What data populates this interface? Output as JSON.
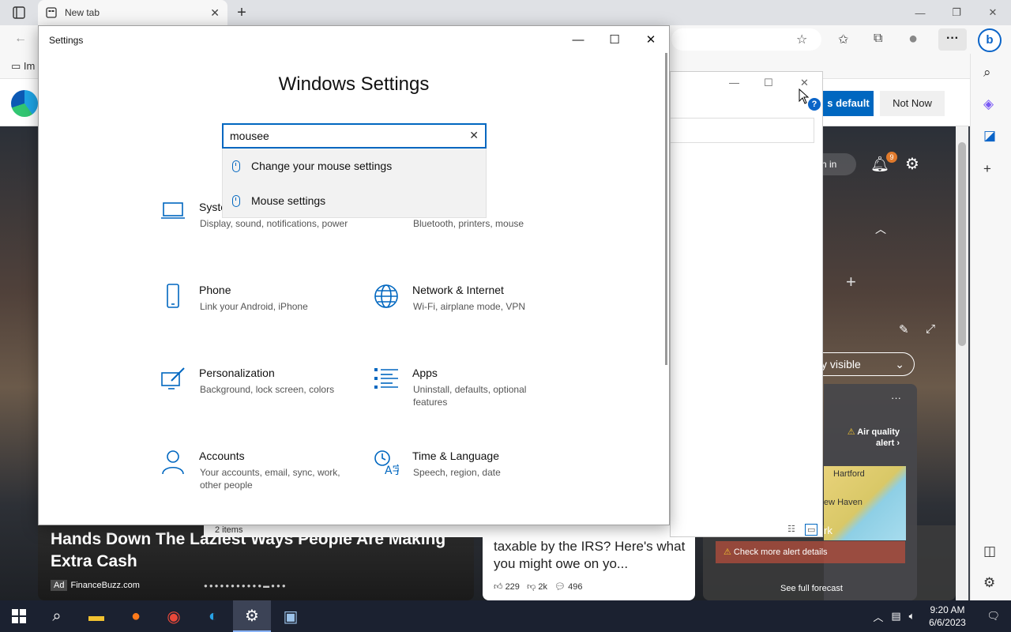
{
  "browser": {
    "tab_title": "New tab",
    "fav_label": "Im",
    "banner_default_label": "s default",
    "banner_not_now_label": "Not Now",
    "sign_in_label": "n in",
    "notification_count": "9",
    "visible_label": "y visible",
    "sidebar_bing_label": "b"
  },
  "settings": {
    "app_title": "Settings",
    "heading": "Windows Settings",
    "search_value": "mousee",
    "suggestions": [
      {
        "label": "Change your mouse settings"
      },
      {
        "label": "Mouse settings"
      }
    ],
    "categories": [
      {
        "title": "Syste",
        "desc": "Display, sound, notifications, power",
        "icon": "laptop-icon"
      },
      {
        "title": "",
        "desc": "Bluetooth, printers, mouse",
        "icon": "devices-icon"
      },
      {
        "title": "Phone",
        "desc": "Link your Android, iPhone",
        "icon": "phone-icon"
      },
      {
        "title": "Network & Internet",
        "desc": "Wi-Fi, airplane mode, VPN",
        "icon": "globe-icon"
      },
      {
        "title": "Personalization",
        "desc": "Background, lock screen, colors",
        "icon": "paint-icon"
      },
      {
        "title": "Apps",
        "desc": "Uninstall, defaults, optional features",
        "icon": "apps-list-icon"
      },
      {
        "title": "Accounts",
        "desc": "Your accounts, email, sync, work, other people",
        "icon": "person-icon"
      },
      {
        "title": "Time & Language",
        "desc": "Speech, region, date",
        "icon": "time-language-icon"
      }
    ]
  },
  "explorer": {
    "status_text": "2 items"
  },
  "news": {
    "headline_1": "Hands Down The Laziest Ways People Are Making Extra Cash",
    "ad_badge": "Ad",
    "ad_source": "FinanceBuzz.com",
    "headline_2": "taxable by the IRS? Here's what you might owe on yo...",
    "likes": "229",
    "dislikes": "2k",
    "comments": "496",
    "air_quality": "Air quality alert",
    "map_label_1": "Hartford",
    "map_label_2": "ew Haven",
    "map_label_3": "rk",
    "alert_details": "Check more alert details",
    "forecast": "See full forecast"
  },
  "taskbar": {
    "time": "9:20 AM",
    "date": "6/6/2023"
  },
  "colors": {
    "accent": "#0067c0",
    "taskbar": "#1b2130"
  }
}
